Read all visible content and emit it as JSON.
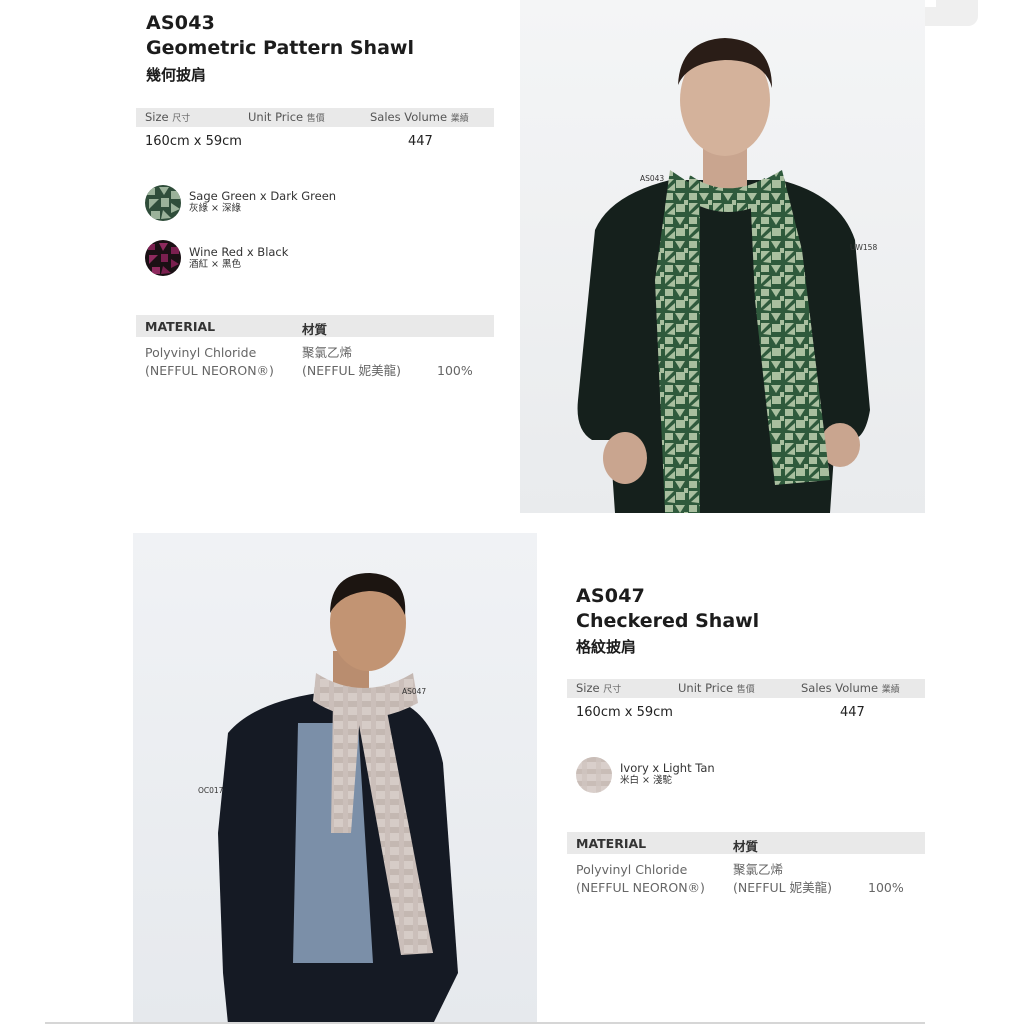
{
  "products": [
    {
      "code": "AS043",
      "name": "Geometric Pattern Shawl",
      "name_zh": "幾何披肩",
      "size_label": "Size",
      "size_label_zh": "尺寸",
      "price_label": "Unit Price",
      "price_label_zh": "售價",
      "volume_label": "Sales Volume",
      "volume_label_zh": "業績",
      "size": "160cm x 59cm",
      "volume": "447",
      "colors": [
        {
          "name": "Sage Green x Dark Green",
          "name_zh": "灰綠 × 深綠",
          "color1": "#9bb29a",
          "color2": "#2f4d3a"
        },
        {
          "name": "Wine Red x Black",
          "name_zh": "酒紅 × 黑色",
          "color1": "#7a1f4f",
          "color2": "#1a1014"
        }
      ],
      "material_label": "MATERIAL",
      "material_label_zh": "材質",
      "material_line1": "Polyvinyl Chloride",
      "material_line2": "(NEFFUL NEORON®)",
      "material_zh_line1": "聚氯乙烯",
      "material_zh_line2": "(NEFFUL 妮美龍)",
      "material_pct": "100%",
      "photo_tags": [
        "AS043",
        "UW158"
      ]
    },
    {
      "code": "AS047",
      "name": "Checkered Shawl",
      "name_zh": "格紋披肩",
      "size_label": "Size",
      "size_label_zh": "尺寸",
      "price_label": "Unit Price",
      "price_label_zh": "售價",
      "volume_label": "Sales Volume",
      "volume_label_zh": "業績",
      "size": "160cm x 59cm",
      "volume": "447",
      "colors": [
        {
          "name": "Ivory x Light Tan",
          "name_zh": "米白 × 淺駝",
          "color1": "#d9cfcb",
          "color2": "#bfb3ad"
        }
      ],
      "material_label": "MATERIAL",
      "material_label_zh": "材質",
      "material_line1": "Polyvinyl Chloride",
      "material_line2": "(NEFFUL NEORON®)",
      "material_zh_line1": "聚氯乙烯",
      "material_zh_line2": "(NEFFUL 妮美龍)",
      "material_pct": "100%",
      "photo_tags": [
        "AS047",
        "OC017"
      ]
    }
  ],
  "colors": {
    "accent_green": "#2f5a3c",
    "sweater": "#15201c",
    "jacket": "#151a24",
    "backdrop": "#eef0f2"
  }
}
